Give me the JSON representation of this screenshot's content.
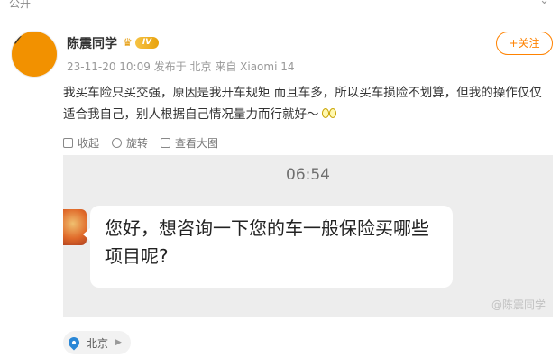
{
  "visibility": {
    "label": "公开"
  },
  "author": {
    "name": "陈震同学",
    "level_badge": "IV",
    "timestamp": "23-11-20 10:09",
    "source": "发布于 北京  来自 Xiaomi 14"
  },
  "follow_button": "+关注",
  "post": {
    "text": "我买车险只买交强，原因是我开车规矩 而且车多，所以买车损险不划算，但我的操作仅仅适合我自己，别人根据自己情况量力而行就好～"
  },
  "actions": {
    "collect": "收起",
    "rotate": "旋转",
    "view_large": "查看大图"
  },
  "image": {
    "time": "06:54",
    "message": "您好，想咨询一下您的车一般保险买哪些项目呢?",
    "watermark": "@陈震同学"
  },
  "location": {
    "label": "北京"
  },
  "colors": {
    "accent": "#ff8200",
    "pin": "#2a87d6"
  }
}
